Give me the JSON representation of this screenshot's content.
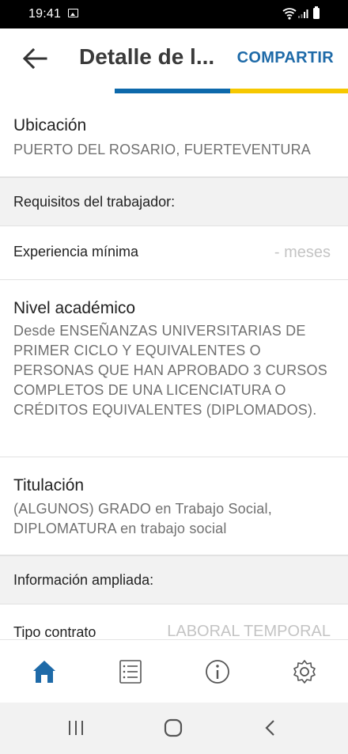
{
  "status_bar": {
    "time": "19:41"
  },
  "app_bar": {
    "title": "Detalle de l...",
    "share_label": "COMPARTIR"
  },
  "colors": {
    "accent_blue": "#0d69ab",
    "accent_yellow": "#f6c800",
    "link_blue": "#1e6aa8",
    "nav_active": "#1e6aa8"
  },
  "details": {
    "location": {
      "label": "Ubicación",
      "value": "PUERTO DEL ROSARIO, FUERTEVENTURA"
    },
    "requirements_header": "Requisitos del trabajador:",
    "min_experience": {
      "label": "Experiencia mínima",
      "value": "- meses"
    },
    "academic_level": {
      "label": "Nivel académico",
      "value": "Desde ENSEÑANZAS UNIVERSITARIAS DE PRIMER CICLO Y EQUIVALENTES O PERSONAS QUE HAN APROBADO 3 CURSOS COMPLETOS DE UNA LICENCIATURA O CRÉDITOS EQUIVALENTES (DIPLOMADOS)."
    },
    "degree": {
      "label": "Titulación",
      "value": "(ALGUNOS) GRADO en Trabajo Social, DIPLOMATURA en trabajo social"
    },
    "extended_header": "Información ampliada:",
    "contract_type": {
      "label": "Tipo contrato",
      "value": "LABORAL TEMPORAL"
    }
  },
  "bottom_nav": {
    "items": [
      {
        "icon": "home-icon",
        "active": true
      },
      {
        "icon": "list-icon",
        "active": false
      },
      {
        "icon": "info-icon",
        "active": false
      },
      {
        "icon": "settings-icon",
        "active": false
      }
    ]
  },
  "system_nav": {
    "icons": [
      "recents-icon",
      "home-circle-icon",
      "back-chevron-icon"
    ]
  }
}
